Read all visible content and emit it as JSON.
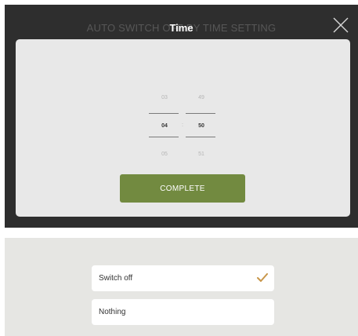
{
  "modal": {
    "background_title": "AUTO SWITCH OFF BY TIME SETTING",
    "title": "Time",
    "close_icon": "close-icon",
    "picker": {
      "hours": {
        "prev": "03",
        "current": "04",
        "next": "05"
      },
      "minutes": {
        "prev": "49",
        "current": "50",
        "next": "51"
      },
      "separator": ":"
    },
    "complete_label": "COMPLETE"
  },
  "options": {
    "items": [
      {
        "label": "Switch off",
        "selected": true
      },
      {
        "label": "Nothing",
        "selected": false
      }
    ],
    "check_icon": "checkmark-icon"
  },
  "colors": {
    "accent_green": "#728a40",
    "check_orange": "#c8964a",
    "overlay_dark": "#2e2e2e"
  }
}
